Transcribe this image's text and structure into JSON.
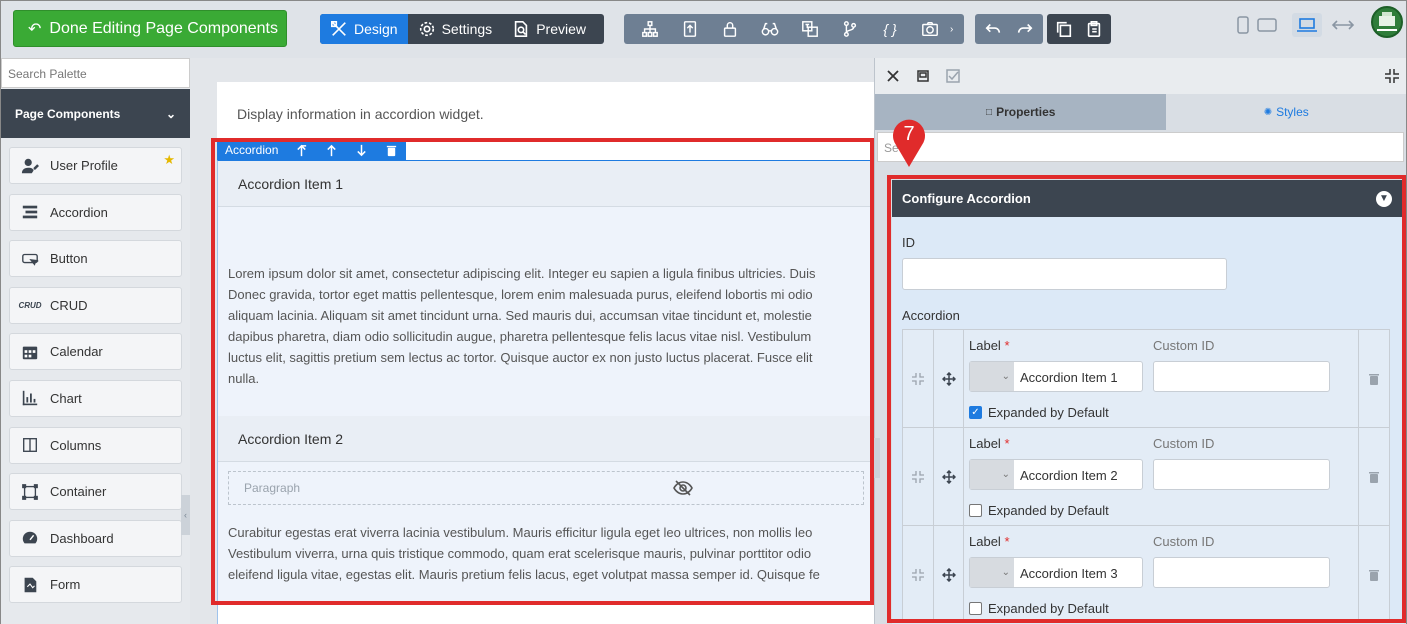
{
  "topbar": {
    "done_label": "Done Editing Page Components",
    "modes": [
      {
        "label": "Design",
        "icon": "design-tools-icon",
        "active": true
      },
      {
        "label": "Settings",
        "icon": "gear-icon",
        "active": false
      },
      {
        "label": "Preview",
        "icon": "document-search-icon",
        "active": false
      }
    ],
    "tools": [
      "sitemap-icon",
      "upload-file-icon",
      "lock-icon",
      "binoculars-icon",
      "translate-icon",
      "branch-icon",
      "code-braces-icon",
      "camera-icon"
    ],
    "history": [
      "undo-icon",
      "redo-icon"
    ],
    "clipboard": [
      "copy-icon",
      "paste-icon"
    ],
    "devices": [
      "phone-icon",
      "tablet-icon",
      "laptop-icon",
      "fit-width-icon"
    ]
  },
  "palette": {
    "search_placeholder": "Search Palette",
    "section_title": "Page Components",
    "items": [
      {
        "label": "User Profile",
        "icon": "user-edit-icon",
        "favorite": true
      },
      {
        "label": "Accordion",
        "icon": "accordion-icon",
        "favorite": false
      },
      {
        "label": "Button",
        "icon": "button-icon",
        "favorite": false
      },
      {
        "label": "CRUD",
        "icon": "crud-icon",
        "favorite": false
      },
      {
        "label": "Calendar",
        "icon": "calendar-icon",
        "favorite": false
      },
      {
        "label": "Chart",
        "icon": "chart-icon",
        "favorite": false
      },
      {
        "label": "Columns",
        "icon": "columns-icon",
        "favorite": false
      },
      {
        "label": "Container",
        "icon": "container-icon",
        "favorite": false
      },
      {
        "label": "Dashboard",
        "icon": "dashboard-icon",
        "favorite": false
      },
      {
        "label": "Form",
        "icon": "form-icon",
        "favorite": false
      }
    ]
  },
  "canvas": {
    "intro": "Display information in accordion widget.",
    "toolbar_label": "Accordion",
    "item1_title": "Accordion Item 1",
    "item1_lines": [
      "Lorem ipsum dolor sit amet, consectetur adipiscing elit. Integer eu sapien a ligula finibus ultricies. Duis",
      "Donec gravida, tortor eget mattis pellentesque, lorem enim malesuada purus, eleifend lobortis mi odio",
      "aliquam lacinia. Aliquam sit amet tincidunt urna. Sed mauris dui, accumsan vitae tincidunt et, molestie",
      "dapibus pharetra, diam odio sollicitudin augue, pharetra pellentesque felis lacus vitae nisl. Vestibulum",
      "luctus elit, sagittis pretium sem lectus ac tortor. Quisque auctor ex non justo luctus placerat. Fusce elit",
      "nulla."
    ],
    "item2_title": "Accordion Item 2",
    "paragraph_placeholder": "Paragraph",
    "item2_lines": [
      "Curabitur egestas erat viverra lacinia vestibulum. Mauris efficitur ligula eget leo ultrices, non mollis leo",
      "Vestibulum viverra, urna quis tristique commodo, quam erat scelerisque mauris, pulvinar porttitor odio",
      "eleifend ligula vitae, egestas elit. Mauris pretium felis lacus, eget volutpat massa semper id. Quisque fe"
    ]
  },
  "panel": {
    "tab_properties": "Properties",
    "tab_styles": "Styles",
    "search_placeholder": "Se",
    "config_title": "Configure Accordion",
    "id_label": "ID",
    "id_value": "",
    "accordion_label": "Accordion",
    "label_caption": "Label",
    "required_mark": "*",
    "custom_id_caption": "Custom ID",
    "expanded_caption": "Expanded by Default",
    "rows": [
      {
        "label": "Accordion Item 1",
        "custom_id": "",
        "expanded": true
      },
      {
        "label": "Accordion Item 2",
        "custom_id": "",
        "expanded": false
      },
      {
        "label": "Accordion Item 3",
        "custom_id": "",
        "expanded": false
      }
    ]
  },
  "annotation": {
    "step_number": "7",
    "color": "#e02b2b"
  }
}
